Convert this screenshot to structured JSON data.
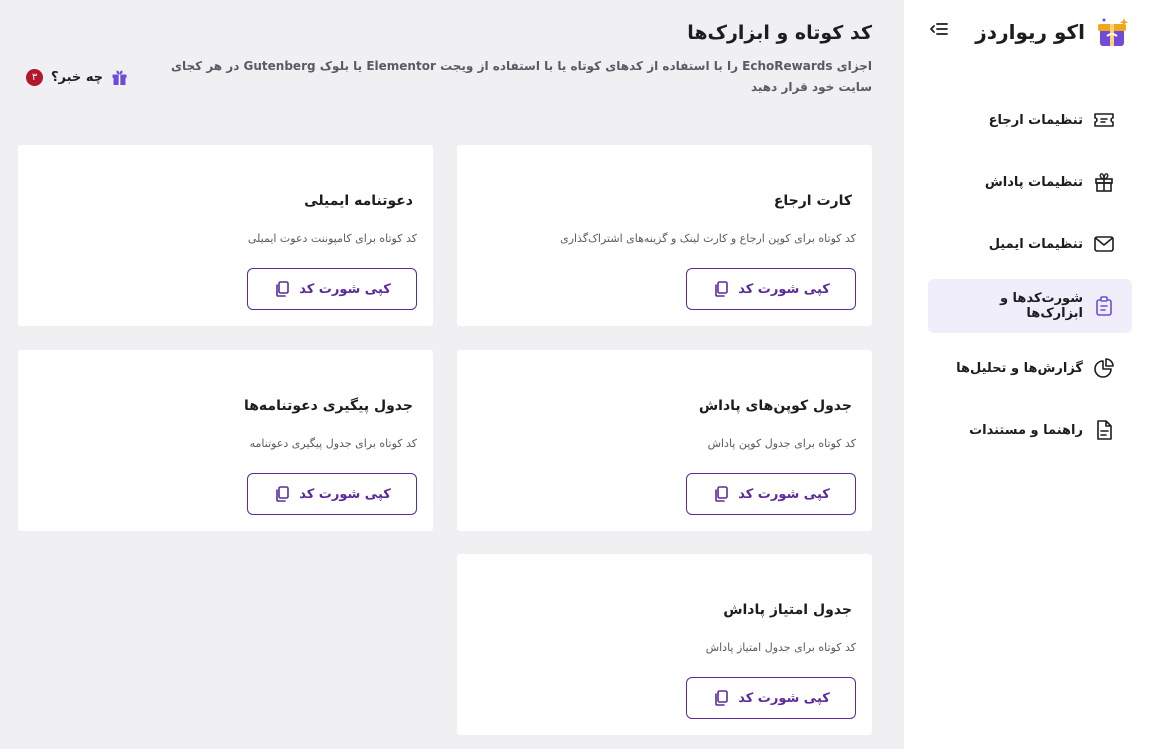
{
  "app": {
    "name": "اکو ریواردز"
  },
  "colors": {
    "accent": "#5b2b9a",
    "badge": "#b0182c",
    "active_bg": "#f0eefb"
  },
  "sidebar": {
    "items": [
      {
        "label": "تنظیمات ارجاع",
        "icon": "ticket-icon",
        "active": false
      },
      {
        "label": "تنظیمات پاداش",
        "icon": "gift-icon",
        "active": false
      },
      {
        "label": "تنظیمات ایمیل",
        "icon": "mail-icon",
        "active": false
      },
      {
        "label": "شورت‌کدها و ابزارک‌ها",
        "icon": "clipboard-icon",
        "active": true
      },
      {
        "label": "گزارش‌ها و تحلیل‌ها",
        "icon": "pie-chart-icon",
        "active": false
      },
      {
        "label": "راهنما و مستندات",
        "icon": "document-icon",
        "active": false
      }
    ]
  },
  "header": {
    "title": "کد کوتاه و ابزارک‌ها",
    "description": "اجزای EchoRewards را با استفاده از کدهای کوتاه یا با استفاده از ویجت Elementor یا بلوک Gutenberg در هر کجای سایت خود قرار دهید",
    "whats_new_label": "چه خبر؟",
    "whats_new_count": "۳"
  },
  "cards": [
    {
      "title": "کارت ارجاع",
      "desc": "کد کوتاه برای کوپن ارجاع و کارت لینک و گزینه‌های اشتراک‌گذاری",
      "button": "کپی شورت کد"
    },
    {
      "title": "دعوتنامه ایمیلی",
      "desc": "کد کوتاه برای کامپوننت دعوت ایمیلی",
      "button": "کپی شورت کد"
    },
    {
      "title": "جدول کوپن‌های پاداش",
      "desc": "کد کوتاه برای جدول کوپن پاداش",
      "button": "کپی شورت کد"
    },
    {
      "title": "جدول پیگیری دعوتنامه‌ها",
      "desc": "کد کوتاه برای جدول پیگیری دعوتنامه",
      "button": "کپی شورت کد"
    },
    {
      "title": "جدول امتیاز پاداش",
      "desc": "کد کوتاه برای جدول امتیاز پاداش",
      "button": "کپی شورت کد"
    }
  ]
}
